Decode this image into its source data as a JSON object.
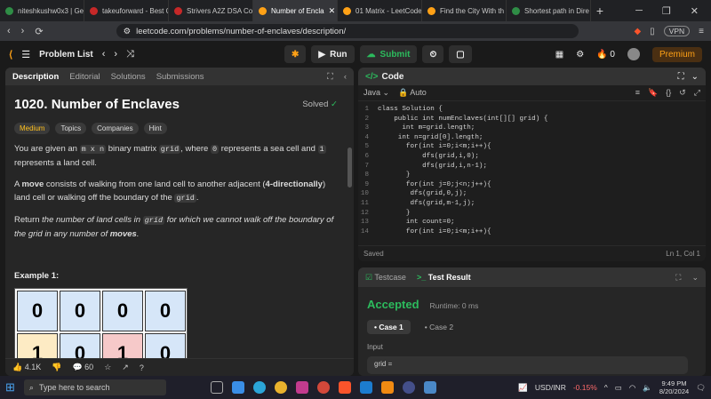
{
  "browser": {
    "tabs": [
      {
        "title": "niteshkushw0x3 | Gee",
        "color": "#2f8d46"
      },
      {
        "title": "takeuforward - Best C",
        "color": "#c62828"
      },
      {
        "title": "Strivers A2Z DSA Co",
        "color": "#c62828"
      },
      {
        "title": "Number of Encla",
        "color": "#ffa116",
        "active": true
      },
      {
        "title": "01 Matrix - LeetCode",
        "color": "#ffa116"
      },
      {
        "title": "Find the City With th",
        "color": "#ffa116"
      },
      {
        "title": "Shortest path in Dire",
        "color": "#2f8d46"
      }
    ],
    "url": "leetcode.com/problems/number-of-enclaves/description/",
    "vpn": "VPN"
  },
  "lc": {
    "problem_list": "Problem List",
    "run": "Run",
    "submit": "Submit",
    "streak": "0",
    "premium": "Premium"
  },
  "left": {
    "tabs": [
      "Description",
      "Editorial",
      "Solutions",
      "Submissions"
    ],
    "title": "1020. Number of Enclaves",
    "solved": "Solved",
    "chips": [
      "Medium",
      "Topics",
      "Companies",
      "Hint"
    ],
    "p1": {
      "a": "You are given an ",
      "b": "m x n",
      "c": " binary matrix ",
      "d": "grid",
      "e": ", where ",
      "f": "0",
      "g": " represents a sea cell and ",
      "h": "1",
      "i": " represents a land cell."
    },
    "p2": {
      "a": "A ",
      "b": "move",
      "c": " consists of walking from one land cell to another adjacent (",
      "d": "4-directionally",
      "e": ") land cell or walking off the boundary of the ",
      "f": "grid",
      "g": "."
    },
    "p3": {
      "a": "Return ",
      "b": "the number of land cells in ",
      "c": "grid",
      "d": " for which we cannot walk off the boundary of the grid in any number of ",
      "e": "moves",
      "f": "."
    },
    "example": "Example 1:",
    "grid": [
      [
        "0",
        "0",
        "0",
        "0"
      ],
      [
        "1",
        "0",
        "1",
        "0"
      ]
    ],
    "likes": "4.1K",
    "comments": "60"
  },
  "code": {
    "title": "Code",
    "lang": "Java",
    "mode": "Auto",
    "saved": "Saved",
    "pos": "Ln 1, Col 1",
    "lines": [
      {
        "n": "1",
        "t": "class Solution {"
      },
      {
        "n": "2",
        "t": "    public int numEnclaves(int[][] grid) {"
      },
      {
        "n": "3",
        "t": "      int m=grid.length;"
      },
      {
        "n": "4",
        "t": "     int n=grid[0].length;"
      },
      {
        "n": "5",
        "t": "       for(int i=0;i<m;i++){"
      },
      {
        "n": "6",
        "t": "           dfs(grid,i,0);"
      },
      {
        "n": "7",
        "t": "           dfs(grid,i,n-1);"
      },
      {
        "n": "8",
        "t": "       }"
      },
      {
        "n": "9",
        "t": "       for(int j=0;j<n;j++){"
      },
      {
        "n": "10",
        "t": "        dfs(grid,0,j);"
      },
      {
        "n": "11",
        "t": "        dfs(grid,m-1,j);"
      },
      {
        "n": "12",
        "t": "       }"
      },
      {
        "n": "13",
        "t": "       int count=0;"
      },
      {
        "n": "14",
        "t": "       for(int i=0;i<m;i++){"
      }
    ]
  },
  "result": {
    "tabs": [
      "Testcase",
      "Test Result"
    ],
    "status": "Accepted",
    "runtime": "Runtime: 0 ms",
    "cases": [
      "Case 1",
      "Case 2"
    ],
    "input_label": "Input",
    "input": "grid ="
  },
  "taskbar": {
    "search": "Type here to search",
    "currency": "USD/INR",
    "change": "-0.15%",
    "time": "9:49 PM",
    "date": "8/20/2024"
  }
}
